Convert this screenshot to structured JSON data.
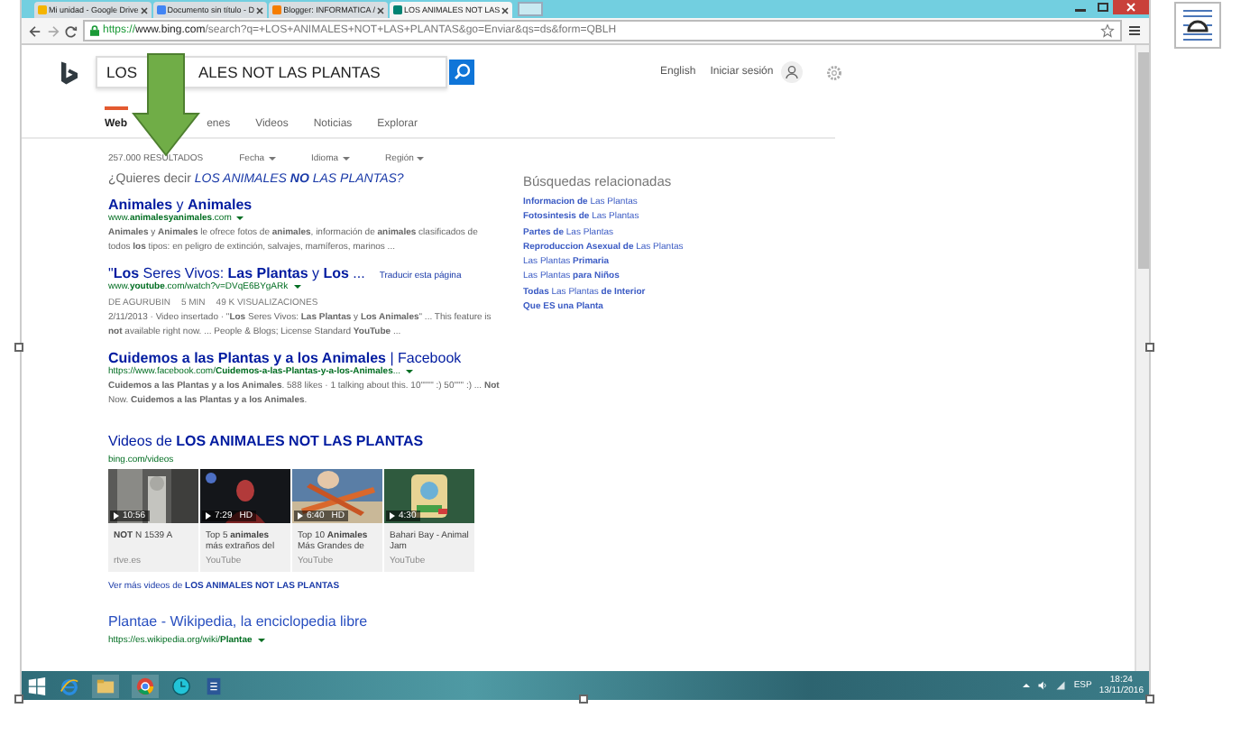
{
  "browser": {
    "tabs": [
      {
        "title": "Mi unidad - Google Drive",
        "kind": "drive",
        "selected": false
      },
      {
        "title": "Documento sin título - D",
        "kind": "docs",
        "selected": false
      },
      {
        "title": "Blogger: INFORMATICA /",
        "kind": "blogger",
        "selected": false
      },
      {
        "title": "LOS ANIMALES NOT LAS",
        "kind": "bing",
        "selected": true
      }
    ],
    "url": {
      "scheme": "https://",
      "host": "www.bing.com",
      "path": "/search?q=+LOS+ANIMALES+NOT+LAS+PLANTAS&go=Enviar&qs=ds&form=QBLH"
    }
  },
  "search": {
    "value_parts": [
      "LOS",
      "ALES NOT LAS PLANTAS"
    ]
  },
  "header_links": [
    "English",
    "Iniciar sesión"
  ],
  "nav": [
    {
      "label": "Web",
      "selected": true
    },
    {
      "label": "enes",
      "selected": false
    },
    {
      "label": "Videos",
      "selected": false
    },
    {
      "label": "Noticias",
      "selected": false
    },
    {
      "label": "Explorar",
      "selected": false
    }
  ],
  "result_count": "257.000 RESULTADOS",
  "filters": [
    "Fecha",
    "Idioma",
    "Región"
  ],
  "suggestion": {
    "prefix": "¿Quieres decir",
    "query": "LOS ANIMALES **NO** LAS PLANTAS?"
  },
  "results": [
    {
      "title": "**Animales** y **Animales**",
      "url": "www.**animalesyanimales**.com",
      "snippet": "**Animales** y **Animales** le ofrece fotos de **animales**, información de **animales** clasificados de todos **los** tipos: en peligro de extinción, salvajes, mamíferos, marinos ..."
    },
    {
      "title": "\"**Los** Seres Vivos: **Las Plantas** y **Los** ...",
      "translate": "Traducir esta página",
      "url": "www.**youtube**.com/watch?v=DVqE6BYgARk",
      "meta": [
        "DE AGURUBIN",
        "5 MIN",
        "49 K VISUALIZACIONES"
      ],
      "snippet": "2/11/2013 · Video insertado · \"**Los** Seres Vivos: **Las Plantas** y **Los Animales**\" ... This feature is **not** available right now. ... People & Blogs; License Standard **YouTube** ..."
    },
    {
      "title": "**Cuidemos a las Plantas y a los Animales** | Facebook",
      "url": "https://www.facebook.com/**Cuidemos-a-las-Plantas-y-a-los-Animales**...",
      "snippet": "**Cuidemos a las Plantas y a los Animales**. 588 likes · 1 talking about this. 10\"\"\"\" :) 50\"\"\" :) ... **Not** Now. **Cuidemos a las Plantas y a los Animales**."
    }
  ],
  "videos": {
    "title": "Videos de **LOS ANIMALES NOT LAS PLANTAS**",
    "source": "bing.com/videos",
    "items": [
      {
        "duration": "10:56",
        "caption": "**NOT** N 1539 A",
        "source": "rtve.es"
      },
      {
        "duration": "7:29",
        "quality": "HD",
        "caption": "Top 5 **animales** más extraños del",
        "source": "YouTube"
      },
      {
        "duration": "6:40",
        "quality": "HD",
        "caption": "Top 10 **Animales** Más Grandes de",
        "source": "YouTube"
      },
      {
        "duration": "4:30",
        "caption": "Bahari Bay - Animal Jam",
        "source": "YouTube"
      }
    ],
    "more": "Ver más videos de **LOS ANIMALES NOT LAS PLANTAS**"
  },
  "last_result": {
    "title": "Plantae - Wikipedia, la enciclopedia libre",
    "url": "https://es.wikipedia.org/wiki/**Plantae**"
  },
  "related": {
    "title": "Búsquedas relacionadas",
    "items": [
      "**Informacion de** Las Plantas",
      "**Fotosintesis de** Las Plantas",
      "**Partes de** Las Plantas",
      "**Reproduccion Asexual de** Las Plantas",
      "Las Plantas **Primaria**",
      "Las Plantas **para Niños**",
      "**Todas** Las Plantas **de Interior**",
      "**Que ES una Planta**"
    ]
  },
  "taskbar": {
    "language": "ESP",
    "time": "18:24",
    "date": "13/11/2016"
  }
}
